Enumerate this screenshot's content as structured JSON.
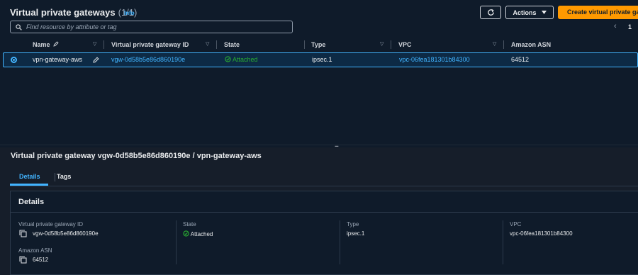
{
  "header": {
    "title": "Virtual private gateways",
    "count": "(1/1)",
    "info": "Info",
    "actions_label": "Actions",
    "create_label": "Create virtual private ga"
  },
  "search": {
    "placeholder": "Find resource by attribute or tag"
  },
  "pager": {
    "prev": "‹",
    "page": "1"
  },
  "table": {
    "columns": [
      "Name",
      "Virtual private gateway ID",
      "State",
      "Type",
      "VPC",
      "Amazon ASN"
    ],
    "rows": [
      {
        "name": "vpn-gateway-aws",
        "id": "vgw-0d58b5e86d860190e",
        "state": "Attached",
        "type": "ipsec.1",
        "vpc": "vpc-06fea181301b84300",
        "asn": "64512"
      }
    ]
  },
  "detail": {
    "title": "Virtual private gateway vgw-0d58b5e86d860190e / vpn-gateway-aws",
    "tabs": [
      "Details",
      "Tags"
    ],
    "card_title": "Details",
    "fields": {
      "id_label": "Virtual private gateway ID",
      "id_value": "vgw-0d58b5e86d860190e",
      "asn_label": "Amazon ASN",
      "asn_value": "64512",
      "state_label": "State",
      "state_value": "Attached",
      "type_label": "Type",
      "type_value": "ipsec.1",
      "vpc_label": "VPC",
      "vpc_value": "vpc-06fea181301b84300"
    }
  },
  "colors": {
    "accent": "#42b4ff",
    "primary": "#ff9900",
    "success": "#29ad32"
  }
}
